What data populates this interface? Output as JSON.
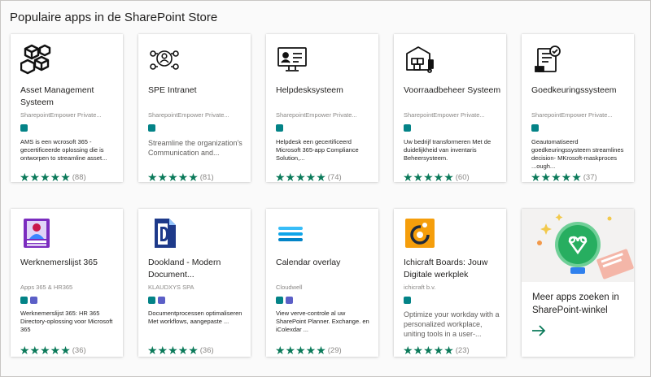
{
  "heading": "Populaire apps in de SharePoint Store",
  "colors": {
    "star": "#0b7a5a",
    "sharepoint": "#038387",
    "teams": "#5b5fc7"
  },
  "apps": [
    {
      "name": "Asset Management Systeem",
      "publisher": "SharepointEmpower Private...",
      "icon": "boxes-icon",
      "description": "AMS is een wcrosoft 365 -gecertificeerde oplossing die is ontworpen to streamline asset...",
      "stars": "★★★★★",
      "count": "(88)"
    },
    {
      "name": "SPE Intranet",
      "publisher": "SharepointEmpower Private...",
      "icon": "people-network-icon",
      "description": "Streamline the organization's Communication and...",
      "stars": "★★★★★",
      "count": "(81)"
    },
    {
      "name": "Helpdesksysteem",
      "publisher": "SharepointEmpower Private...",
      "icon": "helpdesk-monitor-icon",
      "description": "Helpdesk een gecertificeerd Microsoft 365-app Compliance Solution,...",
      "stars": "★★★★★",
      "count": "(74)"
    },
    {
      "name": "Voorraadbeheer Systeem",
      "publisher": "SharepointEmpower Private...",
      "icon": "warehouse-icon",
      "description": "Uw bedrijf transformeren Met de duidelijkheid van inventaris Beheersysteem.",
      "stars": "★★★★★",
      "count": "(60)"
    },
    {
      "name": "Goedkeuringssysteem",
      "publisher": "SharepointEmpower Private...",
      "icon": "approval-document-icon",
      "description": "Geautomatiseerd goedkeuringssysteem streamlines decision- MKrosoft-maskproces ...ough...",
      "stars": "★★★★★",
      "count": "(37)"
    },
    {
      "name": "Werknemerslijst 365",
      "publisher": "Apps 365 & HR365",
      "icon": "employee-directory-icon",
      "description": "Werknemerslijst 365: HR 365 Directory-oplossing voor Microsoft 365",
      "stars": "★★★★★",
      "count": "(36)"
    },
    {
      "name": "Dookland - Modern Document...",
      "publisher": "KLAUDXYS SPA",
      "icon": "document-d-icon",
      "description": "Documentprocessen optimaliseren Met workflows, aangepaste ...",
      "stars": "★★★★★",
      "count": "(36)"
    },
    {
      "name": "Calendar overlay",
      "publisher": "Cloudwell",
      "icon": "calendar-lines-icon",
      "description": "View verve-controle al uw SharePoint Planner. Exchange. en iColexdar ...",
      "stars": "★★★★★",
      "count": "(29)"
    },
    {
      "name": "Ichicraft Boards: Jouw Digitale werkplek",
      "publisher": "ichicraft b.v.",
      "icon": "ichicraft-logo-icon",
      "description": "Optimize your workday with a personalized workplace, uniting tools in a user-...",
      "stars": "★★★★★",
      "count": "(23)"
    }
  ],
  "more": {
    "title": "Meer apps zoeken in SharePoint-winkel",
    "icon": "arrow-right-icon"
  }
}
